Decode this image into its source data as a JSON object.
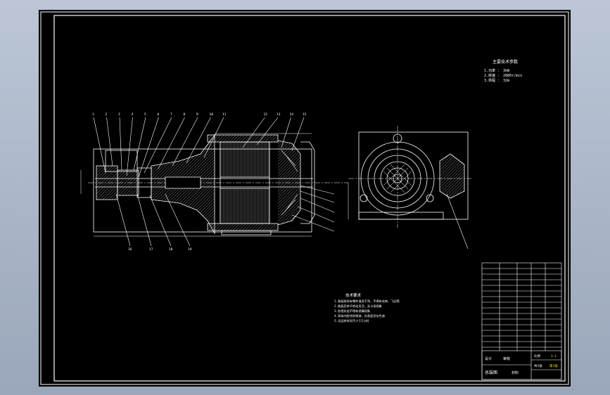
{
  "params_title": "主要技术参数",
  "params_lines": [
    "1.功率 ： 3kW",
    "2.转速 ： 2880r/min",
    "3.扬程 ： 32m"
  ],
  "notes_title": "技术要求",
  "notes_lines": [
    "1.装配前所有零件清洗干净，不得有毛刺、飞边等",
    "2.装配后转子转动灵活，无卡滞现象",
    "3.各密封处不得有渗漏现象",
    "4.泵体内腔涂防锈漆，外表面涂灰色漆",
    "5.试运转时间不少于2小时"
  ],
  "title_block": {
    "drawing_name": "总装图",
    "scale_label": "比例",
    "scale_value": "1:1",
    "sheet_label": "共1张",
    "sheet_no": "第1张",
    "designer_label": "设计",
    "checker_label": "审核",
    "material_label": "材料"
  },
  "part_numbers_top": [
    "1",
    "2",
    "3",
    "4",
    "5",
    "6",
    "7",
    "8",
    "9",
    "10",
    "11",
    "12",
    "13",
    "14",
    "15"
  ],
  "part_numbers_bottom": [
    "16",
    "17",
    "18",
    "19"
  ],
  "colors": {
    "line": "#ffffff",
    "hatch": "#cfcfcf",
    "highlight": "#ffe600",
    "sheet": "#000000"
  }
}
